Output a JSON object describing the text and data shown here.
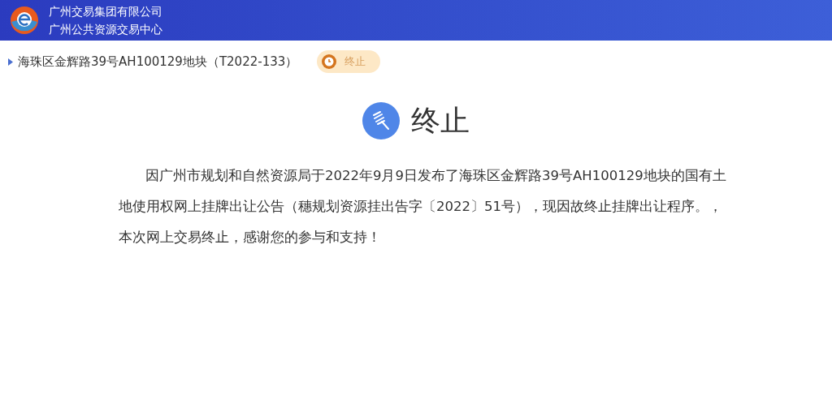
{
  "header": {
    "org_lines": [
      "广州交易集团有限公司",
      "广州公共资源交易中心"
    ]
  },
  "project": {
    "title": "海珠区金辉路39号AH100129地块（T2022-133）",
    "status": "终止"
  },
  "result": {
    "title": "终止",
    "paragraph": "因广州市规划和自然资源局于2022年9月9日发布了海珠区金辉路39号AH100129地块的国有土地使用权网上挂牌出让公告（穗规划资源挂出告字〔2022〕51号），现因故终止挂牌出让程序。，本次网上交易终止，感谢您的参与和支持！"
  }
}
